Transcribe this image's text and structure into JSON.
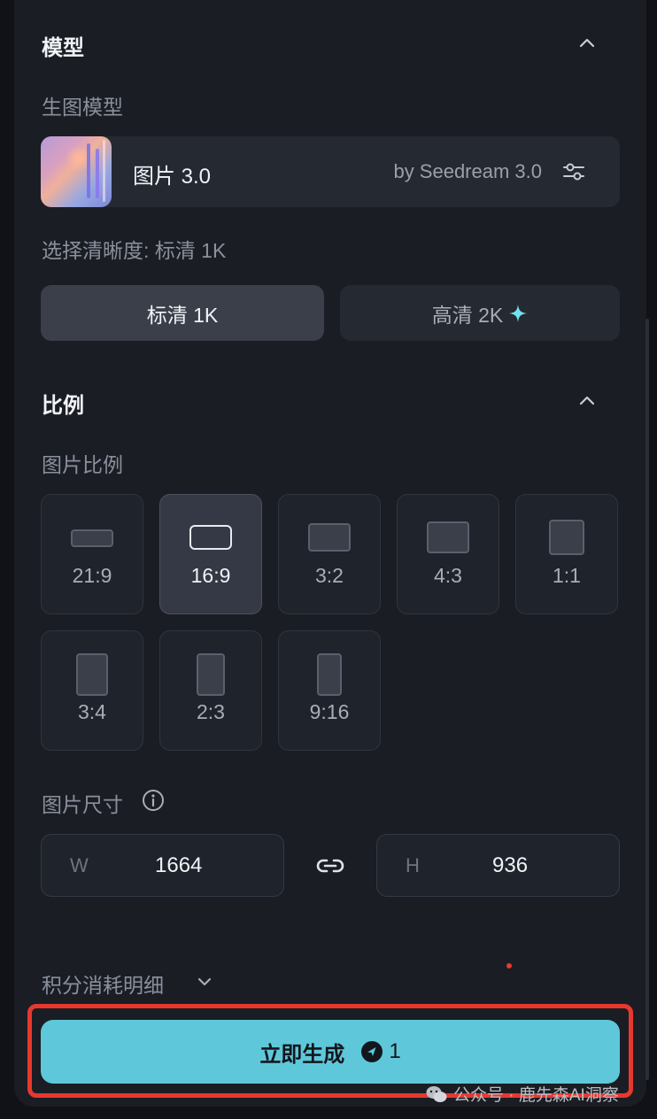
{
  "model_section": {
    "title": "模型",
    "sub_label": "生图模型",
    "model_name": "图片 3.0",
    "model_by": "by Seedream 3.0",
    "resolution_label": "选择清晰度: 标清 1K",
    "resolution_options": [
      {
        "label": "标清 1K",
        "selected": true
      },
      {
        "label": "高清 2K",
        "selected": false
      }
    ]
  },
  "ratio_section": {
    "title": "比例",
    "sub_label": "图片比例",
    "options": [
      {
        "label": "21:9",
        "selected": false
      },
      {
        "label": "16:9",
        "selected": true
      },
      {
        "label": "3:2",
        "selected": false
      },
      {
        "label": "4:3",
        "selected": false
      },
      {
        "label": "1:1",
        "selected": false
      },
      {
        "label": "3:4",
        "selected": false
      },
      {
        "label": "2:3",
        "selected": false
      },
      {
        "label": "9:16",
        "selected": false
      }
    ],
    "size_label": "图片尺寸",
    "width_letter": "W",
    "width_value": "1664",
    "height_letter": "H",
    "height_value": "936"
  },
  "footer": {
    "credits_label": "积分消耗明细",
    "generate_label": "立即生成",
    "generate_cost": "1"
  },
  "watermark": "公众号 · 鹿先森AI洞察",
  "colors": {
    "accent": "#5ec8da",
    "highlight": "#e8382e",
    "panel": "#1a1d24",
    "sparkle": "#6fe3f0"
  },
  "icons": [
    "chevron-up-icon",
    "settings-sliders-icon",
    "sparkle-icon",
    "info-icon",
    "link-icon",
    "chevron-down-icon",
    "coin-icon",
    "wechat-icon"
  ]
}
